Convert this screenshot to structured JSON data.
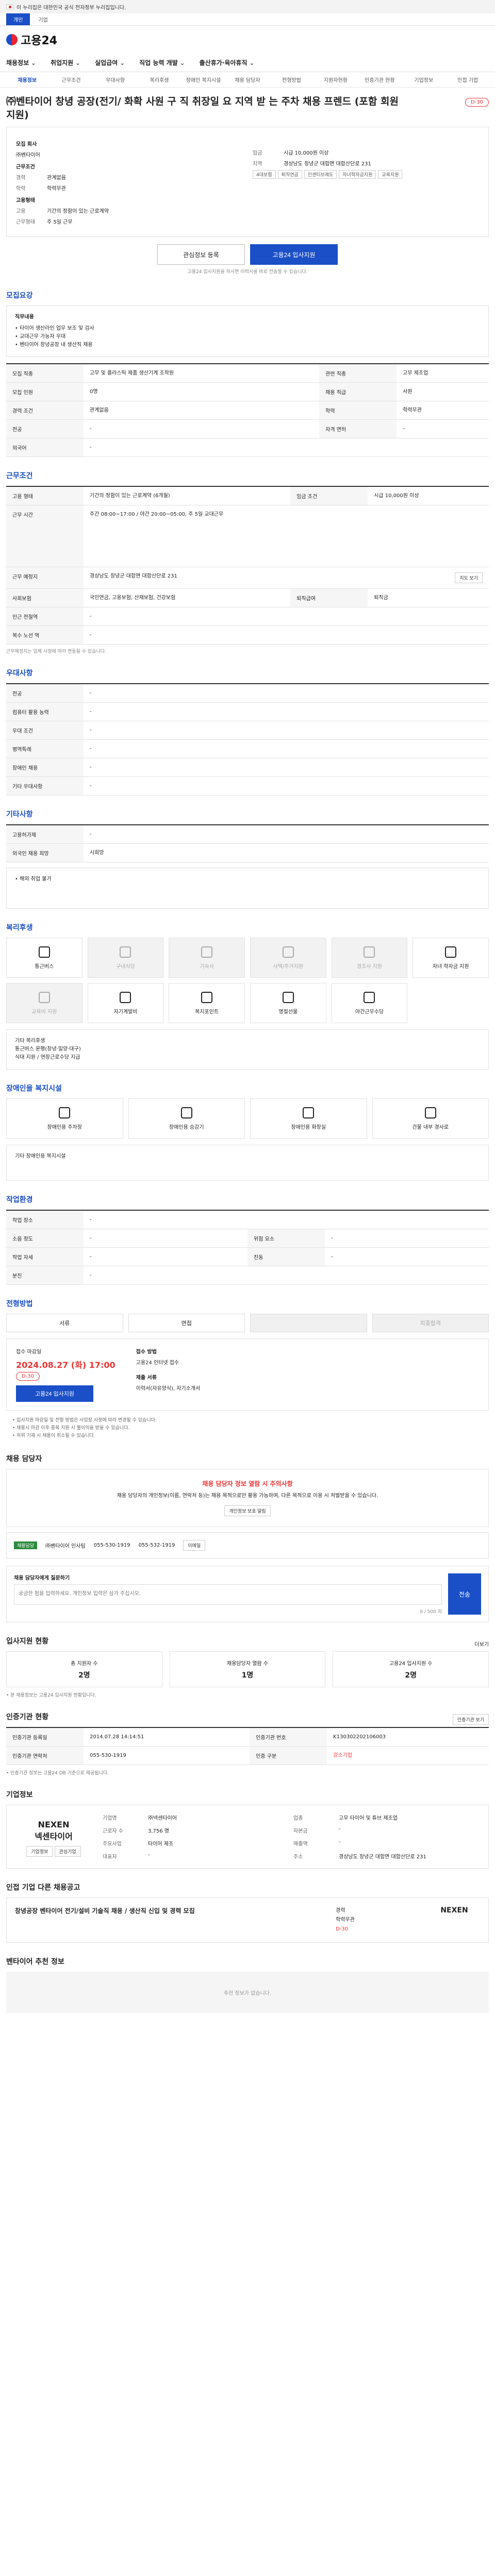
{
  "top": {
    "notice": "이 누리집은 대한민국 공식 전자정부 누리집입니다.",
    "tabs": [
      "개인",
      "기업"
    ]
  },
  "logo": "고용24",
  "gnb": [
    "채용정보",
    "취업지원",
    "실업급여",
    "직업 능력 개발",
    "출산휴가·육아휴직"
  ],
  "subnav": [
    "채용정보",
    "근무조건",
    "우대사항",
    "복리후생",
    "장애인 복지시설",
    "채용 담당자",
    "전형방법",
    "지원자현황",
    "인증기관 현황",
    "기업정보",
    "인접 기업"
  ],
  "job": {
    "title": "㈜벤타이어 창녕 공장(전기/ 화확 사원 구 직 취장일 요 지역 받 는 주차 채용 프렌드 (포함 회원 지원)",
    "dday": "D-30",
    "company_label": "모집 회사",
    "company": "㈜벤타이어",
    "cond_label": "근무조건",
    "rows": [
      {
        "k": "경력",
        "v": "관계없음"
      },
      {
        "k": "학력",
        "v": "학력무관"
      },
      {
        "k": "임금",
        "v": "시급 10,000원 이상"
      },
      {
        "k": "지역",
        "v": "경상남도 창녕군 대합면 대합산단로 231"
      }
    ],
    "type_label": "고용형태",
    "type_row": [
      {
        "k": "고용",
        "v": "기간의 정함이 있는 근로계약"
      },
      {
        "k": "근무형태",
        "v": "주 5일 근무"
      }
    ],
    "chips": [
      "4대보험",
      "퇴직연금",
      "인센티브제도",
      "자녀학자금지원",
      "교육지원"
    ],
    "btn_scrap": "관심정보 등록",
    "btn_apply": "고용24 입사지원",
    "apply_note": "고용24 입사지원을 하시면 이력서를 바로 전송할 수 있습니다."
  },
  "recruit": {
    "h": "모집요강",
    "duty_label": "직무내용",
    "duty": "• 타이어 생산라인 업무 보조 및 검사\n• 교대근무 가능자 우대\n• 벤타이어 창녕공장 내 생산직 채용",
    "rows": [
      {
        "k": "모집 직종",
        "v": "고무 및 플라스틱 제품 생산기계 조작원"
      },
      {
        "k": "관련 직종",
        "v": "고무 제조업"
      },
      {
        "k": "모집 인원",
        "v": "0명"
      },
      {
        "k": "채용 직급",
        "v": "사원"
      },
      {
        "k": "경력 조건",
        "v": "관계없음"
      },
      {
        "k": "학력",
        "v": "학력무관"
      },
      {
        "k": "전공",
        "v": "-"
      },
      {
        "k": "자격 면허",
        "v": "-"
      },
      {
        "k": "외국어",
        "v": "-"
      }
    ]
  },
  "work": {
    "h": "근무조건",
    "rows": [
      {
        "k": "고용 형태",
        "v": "기간의 정함이 있는 근로계약 (6개월)"
      },
      {
        "k": "임금 조건",
        "v": "시급 10,000원 이상"
      },
      {
        "k": "근무 시간",
        "v": "주간 08:00~17:00 / 야간 20:00~05:00, 주 5일 교대근무"
      },
      {
        "k": "근무 예정지",
        "v": "경상남도 창녕군 대합면 대합산단로 231"
      },
      {
        "k": "사회보험",
        "v": "국민연금, 고용보험, 산재보험, 건강보험"
      },
      {
        "k": "퇴직급여",
        "v": "퇴직금"
      },
      {
        "k": "인근 전철역",
        "v": "-"
      },
      {
        "k": "복수 노선 역",
        "v": "-"
      }
    ],
    "map_btn": "지도 보기",
    "note": "근무예정지는 업체 사정에 따라 변동될 수 있습니다."
  },
  "pref": {
    "h": "우대사항",
    "rows": [
      {
        "k": "전공",
        "v": "-"
      },
      {
        "k": "컴퓨터 활용 능력",
        "v": "-"
      },
      {
        "k": "우대 조건",
        "v": "-"
      },
      {
        "k": "병역특례",
        "v": "-"
      },
      {
        "k": "장애인 채용",
        "v": "-"
      },
      {
        "k": "기타 우대사항",
        "v": "-"
      }
    ]
  },
  "etc": {
    "h": "기타사항",
    "rows": [
      {
        "k": "고용허가제",
        "v": "-"
      },
      {
        "k": "외국인 채용 희망",
        "v": "시희망"
      }
    ],
    "box": "• 해외 취업 불가"
  },
  "welfare": {
    "h": "복리후생",
    "items": [
      {
        "n": "통근버스",
        "on": true
      },
      {
        "n": "구내식당",
        "on": false
      },
      {
        "n": "기숙사",
        "on": false
      },
      {
        "n": "사택/주거지원",
        "on": false
      },
      {
        "n": "경조사 지원",
        "on": false
      },
      {
        "n": "자녀 학자금 지원",
        "on": true
      },
      {
        "n": "교육비 지원",
        "on": false
      },
      {
        "n": "자기계발비",
        "on": true
      },
      {
        "n": "복지포인트",
        "on": true
      },
      {
        "n": "명절선물",
        "on": true
      },
      {
        "n": "야간근무수당",
        "on": true
      },
      {
        "n": "",
        "on": false
      }
    ],
    "box": "기타 복리후생\n통근버스 운행(창녕·밀양·대구)\n식대 지원 / 연장근로수당 지급"
  },
  "disab": {
    "h": "장애인을 복지시설",
    "items": [
      "장애인용 주차장",
      "장애인용 승강기",
      "장애인용 화장실",
      "건물 내부 경사로"
    ],
    "box": "기타 장애인용 복지시설"
  },
  "env": {
    "h": "작업환경",
    "rows": [
      {
        "k": "작업 장소",
        "v": "-"
      },
      {
        "k": "소음 정도",
        "v": "-"
      },
      {
        "k": "위험 요소",
        "v": "-"
      },
      {
        "k": "작업 자세",
        "v": "-"
      },
      {
        "k": "진동",
        "v": "-"
      },
      {
        "k": "분진",
        "v": "-"
      }
    ]
  },
  "screen": {
    "h": "전형방법",
    "steps": [
      "서류",
      "면접",
      "",
      "최종합격"
    ],
    "deadline_label": "접수 마감일",
    "deadline": "2024.08.27 (화) 17:00",
    "dday": "D-30",
    "method_label": "접수 방법",
    "method": "고용24 인터넷 접수",
    "papers_label": "제출 서류",
    "papers": "이력서(자유양식), 자기소개서",
    "btn": "고용24 입사지원",
    "notes": "• 입사지원 마감일 및 전형 방법은 사업장 사정에 따라 변경될 수 있습니다.\n• 채용시 마감 이후 중복 지원 시 불이익을 받을 수 있습니다.\n• 허위 기재 시 채용이 취소될 수 있습니다."
  },
  "manager": {
    "h": "채용 담당자",
    "alert_t": "채용 담당자 정보 열람 시 주의사항",
    "alert_b": "채용 담당자의 개인정보(이름, 연락처 등)는 채용 목적으로만 활용 가능하며, 다른 목적으로 이용 시 처벌받을 수 있습니다.",
    "alert_btn": "개인정보 보호 알림",
    "badge": "채용담당",
    "name": "㈜벤타이어 인사팀",
    "phone": "055-530-1919",
    "fax": "055-532-1919",
    "email_btn": "이메일",
    "q_label": "채용 담당자에게 질문하기",
    "q_placeholder": "궁금한 점을 입력하세요. 개인정보 입력은 삼가 주십시오.",
    "q_btn": "전송",
    "q_note": "0 / 500 자"
  },
  "applicants": {
    "h": "입사지원 현황",
    "more": "더보기",
    "stats": [
      {
        "k": "총 지원자 수",
        "v": "2명"
      },
      {
        "k": "채용담당자 열람 수",
        "v": "1명"
      },
      {
        "k": "고용24 입사지원 수",
        "v": "2명"
      }
    ],
    "note": "• 본 채용정보는 고용24 입사지원 현황입니다."
  },
  "cert": {
    "h": "인증기관 현황",
    "btn": "인증기관 보기",
    "rows": [
      {
        "k": "인증기관 등록일",
        "v": "2014.07.28 14:14:51"
      },
      {
        "k": "인증기관 번호",
        "v": "K130302202106003"
      },
      {
        "k": "인증기관 연락처",
        "v": "055-530-1919"
      },
      {
        "k": "인증 구분",
        "v": "강소기업"
      }
    ],
    "note": "• 인증기관 정보는 고용24 DB 기준으로 제공됩니다."
  },
  "company": {
    "h": "기업정보",
    "logo": "NEXEN\n넥센타이어",
    "btn1": "기업정보",
    "btn2": "관심기업",
    "rows": [
      {
        "k": "기업명",
        "v": "㈜넥센타이어"
      },
      {
        "k": "업종",
        "v": "고무 타이어 및 튜브 제조업"
      },
      {
        "k": "근로자 수",
        "v": "3,756 명"
      },
      {
        "k": "자본금",
        "v": "-"
      },
      {
        "k": "주요사업",
        "v": "타이어 제조"
      },
      {
        "k": "매출액",
        "v": "-"
      },
      {
        "k": "대표자",
        "v": "-"
      },
      {
        "k": "주소",
        "v": "경상남도 창녕군 대합면 대합산단로 231"
      }
    ]
  },
  "other": {
    "h": "인접 기업 다른 채용공고",
    "title": "창녕공장 벤타이어 전기/설비 기술직 채용 / 생산직 신입 및 경력 모집",
    "rows": [
      "경력",
      "학력무관",
      "D-30"
    ],
    "logo": "NEXEN"
  },
  "rec": {
    "h": "벤타이어 추천 정보",
    "empty": "추천 정보가 없습니다."
  }
}
